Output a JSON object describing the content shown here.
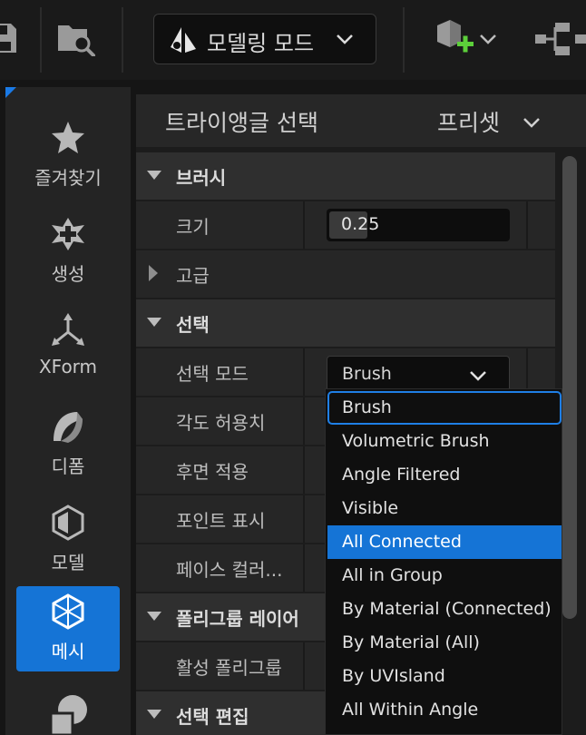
{
  "toolbar": {
    "mode_label": "모델링 모드"
  },
  "modes": [
    {
      "label": "즐겨찾기",
      "icon": "star-icon"
    },
    {
      "label": "생성",
      "icon": "create-icon"
    },
    {
      "label": "XForm",
      "icon": "xform-icon"
    },
    {
      "label": "디폼",
      "icon": "deform-icon"
    },
    {
      "label": "모델",
      "icon": "model-icon"
    },
    {
      "label": "메시",
      "icon": "mesh-icon",
      "active": true
    }
  ],
  "panel": {
    "title": "트라이앵글 선택",
    "preset": "프리셋"
  },
  "rows": {
    "brush_section": "브러시",
    "size_label": "크기",
    "size_value": "0.25",
    "size_fill_fraction": 0.25,
    "advanced_section": "고급",
    "selection_section": "선택",
    "selection_mode_label": "선택 모드",
    "selection_mode_value": "Brush",
    "angle_tolerance_label": "각도 허용치",
    "hit_back_faces_label": "후면 적용",
    "show_points_label": "포인트 표시",
    "face_color_label": "페이스 컬러...",
    "polygroup_layer_section": "폴리그룹 레이어",
    "active_polygroup_label": "활성 폴리그룹",
    "selection_edit_section": "선택 편집"
  },
  "dropdown": {
    "items": [
      "Brush",
      "Volumetric Brush",
      "Angle Filtered",
      "Visible",
      "All Connected",
      "All in Group",
      "By Material (Connected)",
      "By Material (All)",
      "By UVIsland",
      "All Within Angle"
    ],
    "focused_index": 0,
    "highlighted_index": 4
  },
  "colors": {
    "accent": "#1574d6",
    "focus_ring": "#1f7fe6",
    "add_green": "#5ccf3a"
  }
}
